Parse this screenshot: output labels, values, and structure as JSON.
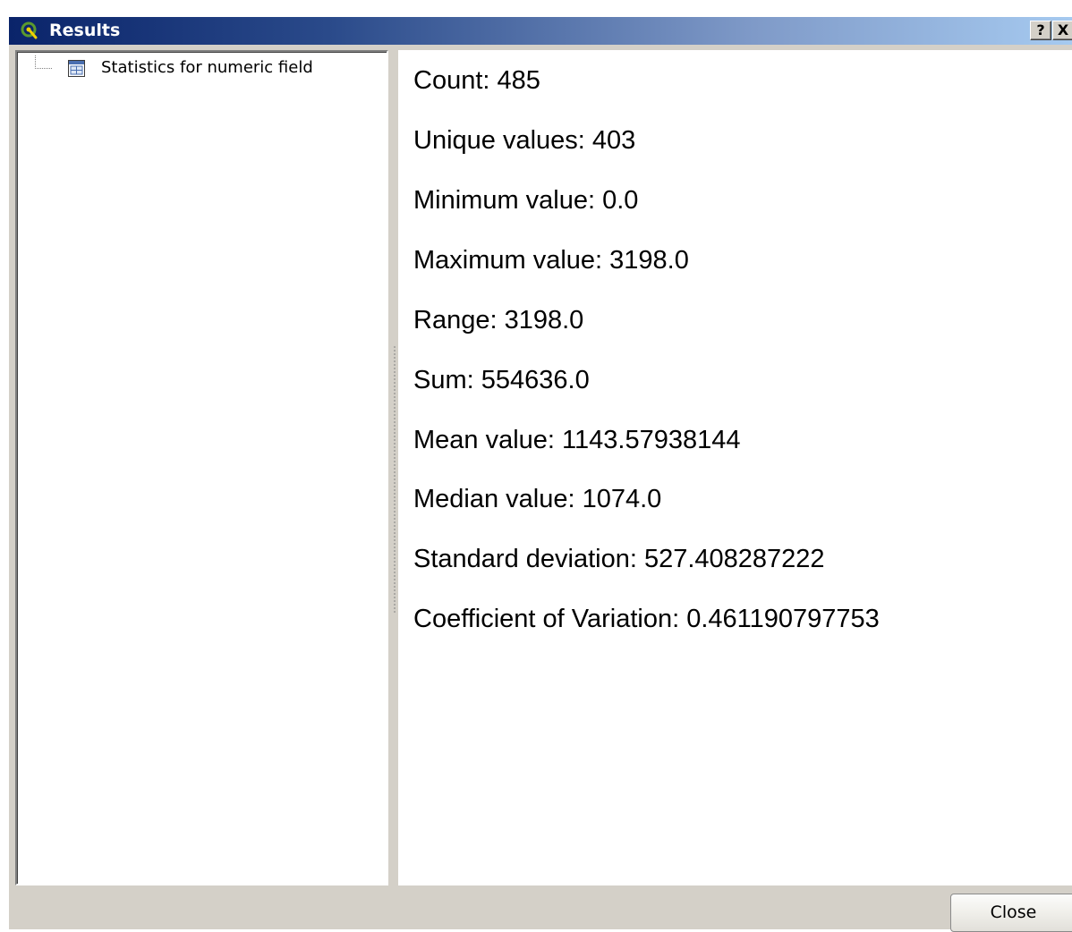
{
  "window": {
    "title": "Results",
    "help_label": "?",
    "close_label": "X"
  },
  "tree": {
    "items": [
      {
        "label": "Statistics for numeric field",
        "icon": "table-icon"
      }
    ]
  },
  "results": {
    "lines": [
      "Count: 485",
      "Unique values: 403",
      "Minimum value: 0.0",
      "Maximum value: 3198.0",
      "Range: 3198.0",
      "Sum: 554636.0",
      "Mean value: 1143.57938144",
      "Median value: 1074.0",
      "Standard deviation: 527.408287222",
      "Coefficient of Variation: 0.461190797753"
    ]
  },
  "footer": {
    "close_button_label": "Close"
  },
  "colors": {
    "titlebar_start": "#0a246a",
    "titlebar_end": "#a6caf0",
    "dialog_bg": "#d4d0c8",
    "app_icon_green": "#5b9a2e"
  }
}
